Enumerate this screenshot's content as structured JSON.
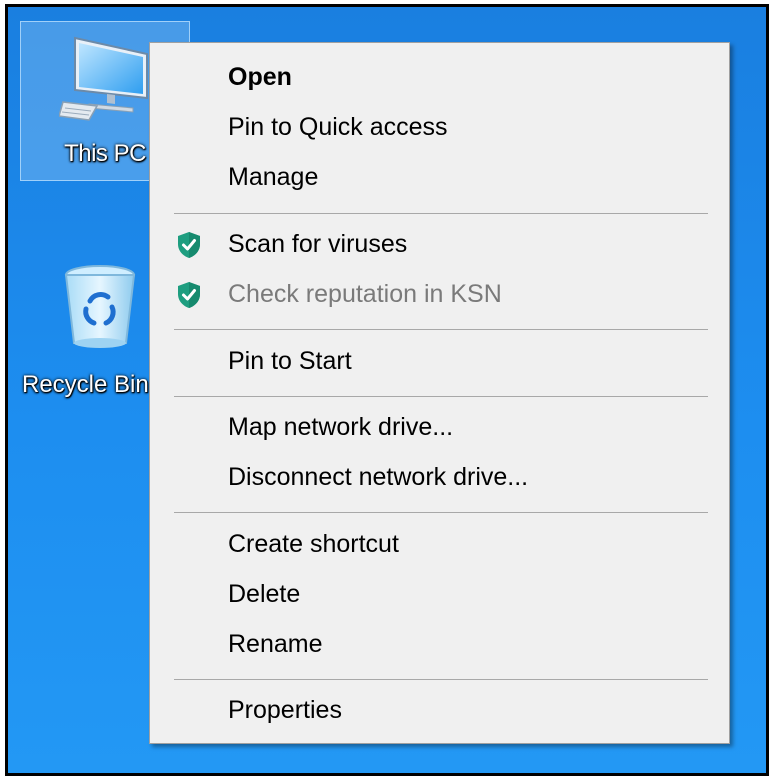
{
  "desktop": {
    "icons": [
      {
        "label": "This PC",
        "selected": true
      },
      {
        "label": "Recycle Bin",
        "selected": false
      }
    ]
  },
  "context_menu": {
    "items": [
      {
        "label": "Open",
        "bold": true
      },
      {
        "label": "Pin to Quick access"
      },
      {
        "label": "Manage"
      },
      {
        "label": "Scan for viruses",
        "icon": "kaspersky-shield-icon"
      },
      {
        "label": "Check reputation in KSN",
        "icon": "kaspersky-shield-icon",
        "disabled": true
      },
      {
        "label": "Pin to Start"
      },
      {
        "label": "Map network drive..."
      },
      {
        "label": "Disconnect network drive..."
      },
      {
        "label": "Create shortcut"
      },
      {
        "label": "Delete"
      },
      {
        "label": "Rename"
      },
      {
        "label": "Properties"
      }
    ]
  },
  "colors": {
    "desktop_blue": "#1d8ef0",
    "menu_background": "#f0f0f0",
    "shield_green": "#1e9e80",
    "disabled_text": "#7a7a7a"
  }
}
